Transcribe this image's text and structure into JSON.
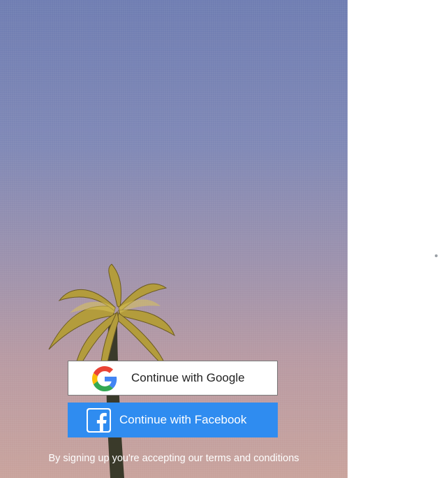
{
  "hero": {
    "image": "palm-tree-sky-photo"
  },
  "auth": {
    "google": {
      "label": "Continue with Google",
      "icon": "google-icon"
    },
    "facebook": {
      "label": "Continue with Facebook",
      "icon": "facebook-icon",
      "color": "#2f8cf0"
    }
  },
  "terms": {
    "text": "By signing up you're accepting our terms and conditions"
  }
}
